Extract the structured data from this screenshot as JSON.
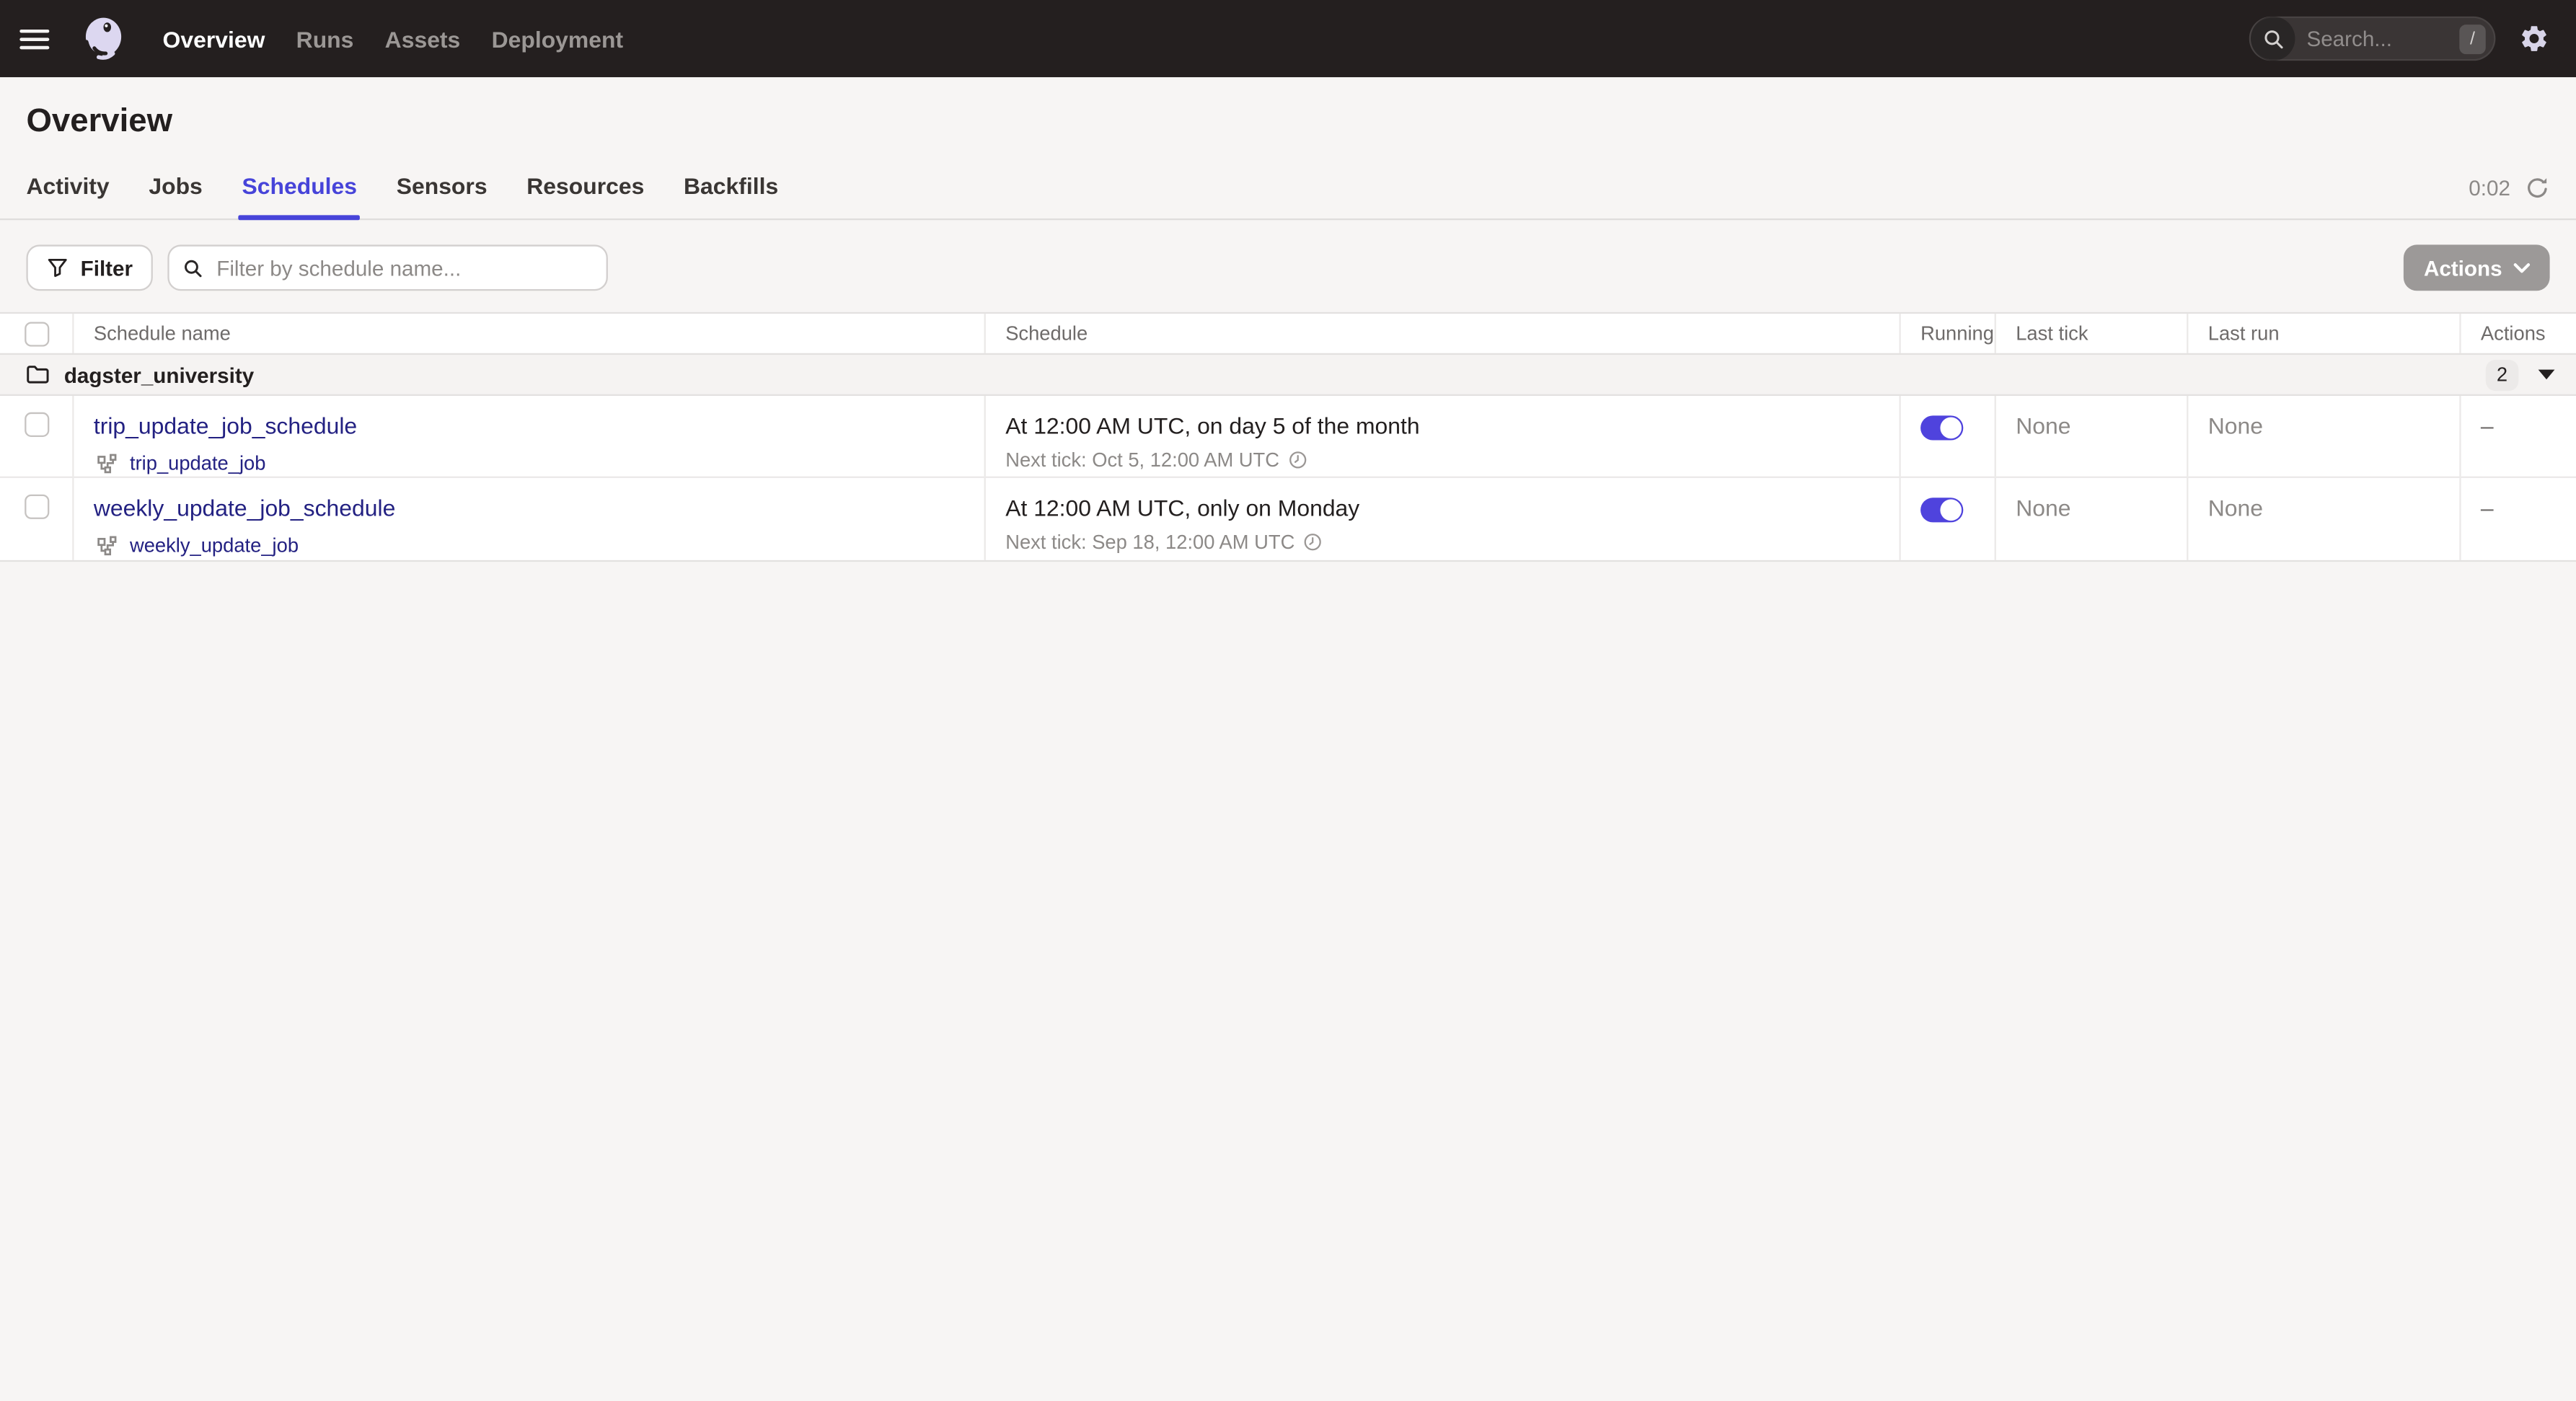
{
  "topbar": {
    "nav": [
      {
        "label": "Overview",
        "active": true
      },
      {
        "label": "Runs",
        "active": false
      },
      {
        "label": "Assets",
        "active": false
      },
      {
        "label": "Deployment",
        "active": false
      }
    ],
    "search_placeholder": "Search...",
    "search_shortcut": "/"
  },
  "page": {
    "title": "Overview"
  },
  "tabs": {
    "items": [
      {
        "label": "Activity",
        "active": false
      },
      {
        "label": "Jobs",
        "active": false
      },
      {
        "label": "Schedules",
        "active": true
      },
      {
        "label": "Sensors",
        "active": false
      },
      {
        "label": "Resources",
        "active": false
      },
      {
        "label": "Backfills",
        "active": false
      }
    ],
    "refresh_timer": "0:02"
  },
  "toolbar": {
    "filter_label": "Filter",
    "filter_placeholder": "Filter by schedule name...",
    "actions_label": "Actions"
  },
  "table": {
    "headers": {
      "name": "Schedule name",
      "schedule": "Schedule",
      "running": "Running",
      "last_tick": "Last tick",
      "last_run": "Last run",
      "actions": "Actions"
    },
    "group": {
      "name": "dagster_university",
      "count": "2"
    },
    "rows": [
      {
        "name": "trip_update_job_schedule",
        "job": "trip_update_job",
        "schedule": "At 12:00 AM UTC, on day 5 of the month",
        "next_tick": "Next tick: Oct 5, 12:00 AM UTC",
        "running": true,
        "last_tick": "None",
        "last_run": "None",
        "actions": "–"
      },
      {
        "name": "weekly_update_job_schedule",
        "job": "weekly_update_job",
        "schedule": "At 12:00 AM UTC, only on Monday",
        "next_tick": "Next tick: Sep 18, 12:00 AM UTC",
        "running": true,
        "last_tick": "None",
        "last_run": "None",
        "actions": "–"
      }
    ]
  },
  "colors": {
    "accent": "#4744D9",
    "link": "#232182",
    "toggle_on": "#4F43DD",
    "topbar_bg": "#241F1F",
    "page_bg": "#F7F5F4"
  }
}
